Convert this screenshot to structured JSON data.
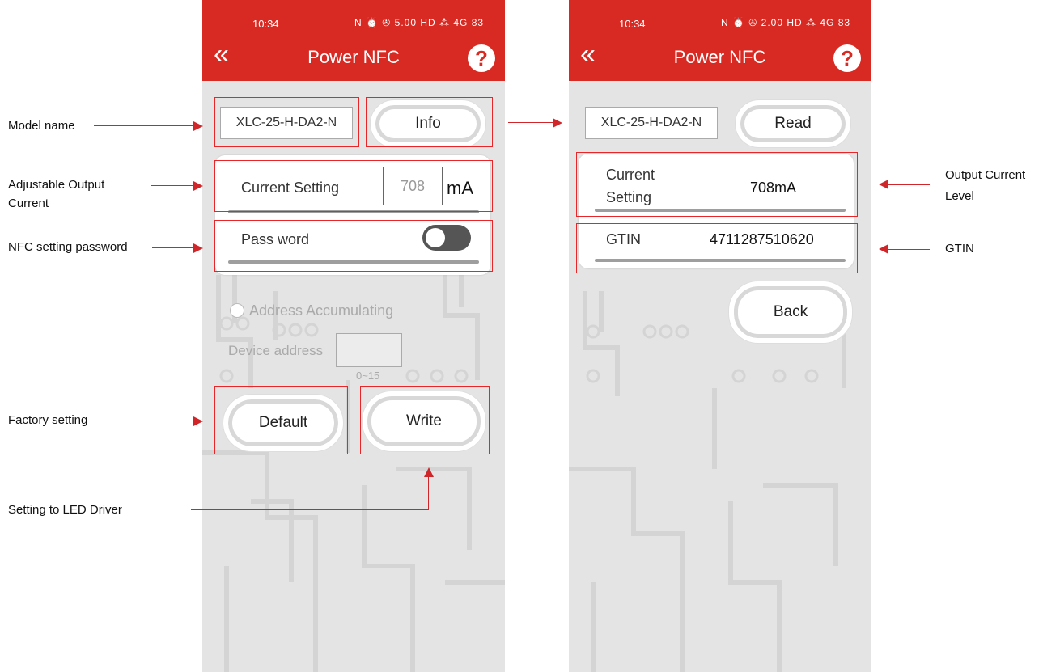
{
  "status_bar": {
    "time": "10:34",
    "icons_left": "N ⏰ ✇ 5.00 HD ⁂ 4G 83",
    "icons_right": "N ⏰ ✇ 2.00 HD ⁂ 4G 83"
  },
  "header": {
    "title": "Power NFC",
    "back_icon": "«",
    "help_icon": "?"
  },
  "left_screen": {
    "model_name": "XLC-25-H-DA2-N",
    "info_button": "Info",
    "current_setting_label": "Current Setting",
    "current_setting_value": "708",
    "current_unit": "mA",
    "password_label": "Pass word",
    "password_toggle_on": false,
    "address_accumulating_label": "Address Accumulating",
    "device_address_label": "Device address",
    "device_address_value": "",
    "device_address_range": "0~15",
    "default_button": "Default",
    "write_button": "Write"
  },
  "right_screen": {
    "model_name": "XLC-25-H-DA2-N",
    "read_button": "Read",
    "current_setting_label_line1": "Current",
    "current_setting_label_line2": "Setting",
    "current_setting_value": "708mA",
    "gtin_label": "GTIN",
    "gtin_value": "4711287510620",
    "back_button": "Back"
  },
  "annotations": {
    "model_name": "Model  name",
    "adjustable_output_line1": "Adjustable Output",
    "adjustable_output_line2": "Current",
    "nfc_password": "NFC setting password",
    "factory_setting": "Factory setting",
    "setting_to_driver": "Setting to LED Driver",
    "output_current_line1": "Output Current",
    "output_current_line2": "Level",
    "gtin": "GTIN"
  },
  "colors": {
    "header_red": "#d82a22",
    "annotation_red": "#d0262a",
    "background_gray": "#e4e4e4"
  }
}
